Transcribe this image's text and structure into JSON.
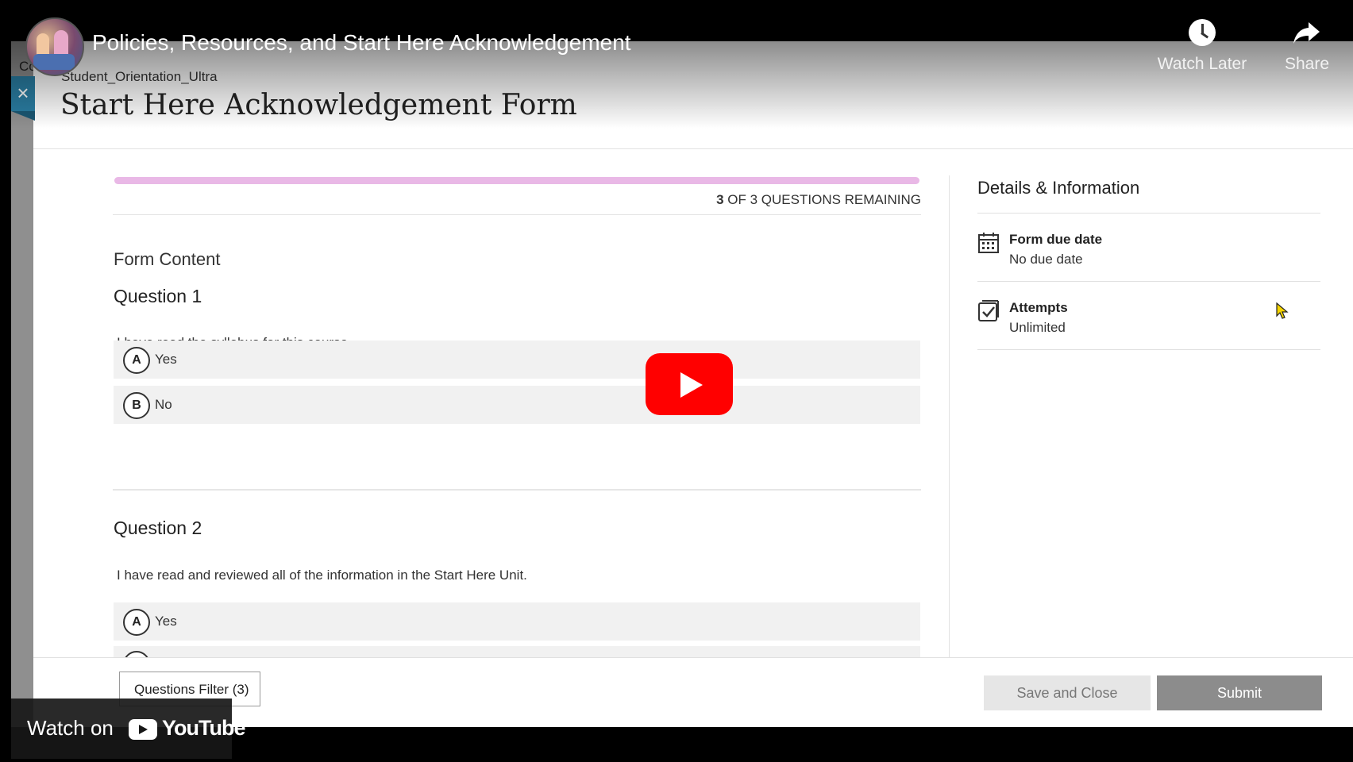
{
  "video": {
    "title": "Policies, Resources, and Start Here Acknowledgement",
    "actions": [
      {
        "label": "Watch Later",
        "icon": "clock-icon"
      },
      {
        "label": "Share",
        "icon": "share-arrow-icon"
      }
    ],
    "watch_on_label": "Watch on",
    "brand_label": "YouTube"
  },
  "background_page": {
    "partial_text": "Co"
  },
  "panel": {
    "course_name": "Student_Orientation_Ultra",
    "title": "Start Here Acknowledgement Form",
    "close_label": "×"
  },
  "progress": {
    "remaining_count": "3",
    "remaining_suffix": "OF 3 QUESTIONS REMAINING",
    "fraction_remaining": 1.0,
    "bar_color": "#e9b8e6"
  },
  "form": {
    "section_label": "Form Content",
    "questions": [
      {
        "title": "Question 1",
        "text": "I have read the syllabus for this course.",
        "options": [
          {
            "letter": "A",
            "label": "Yes"
          },
          {
            "letter": "B",
            "label": "No"
          }
        ]
      },
      {
        "title": "Question 2",
        "text": "I have read and reviewed all of the information in the Start Here Unit.",
        "options": [
          {
            "letter": "A",
            "label": "Yes"
          }
        ]
      }
    ]
  },
  "details": {
    "title": "Details & Information",
    "items": [
      {
        "label": "Form due date",
        "value": "No due date",
        "icon": "calendar-icon"
      },
      {
        "label": "Attempts",
        "value": "Unlimited",
        "icon": "checkbox-icon"
      }
    ]
  },
  "footer": {
    "filter_label": "Questions Filter (3)",
    "save_label": "Save and Close",
    "submit_label": "Submit"
  },
  "colors": {
    "youtube_red": "#ff0000",
    "close_blue": "#2a7ea3",
    "submit_gray": "#8c8c8c"
  }
}
